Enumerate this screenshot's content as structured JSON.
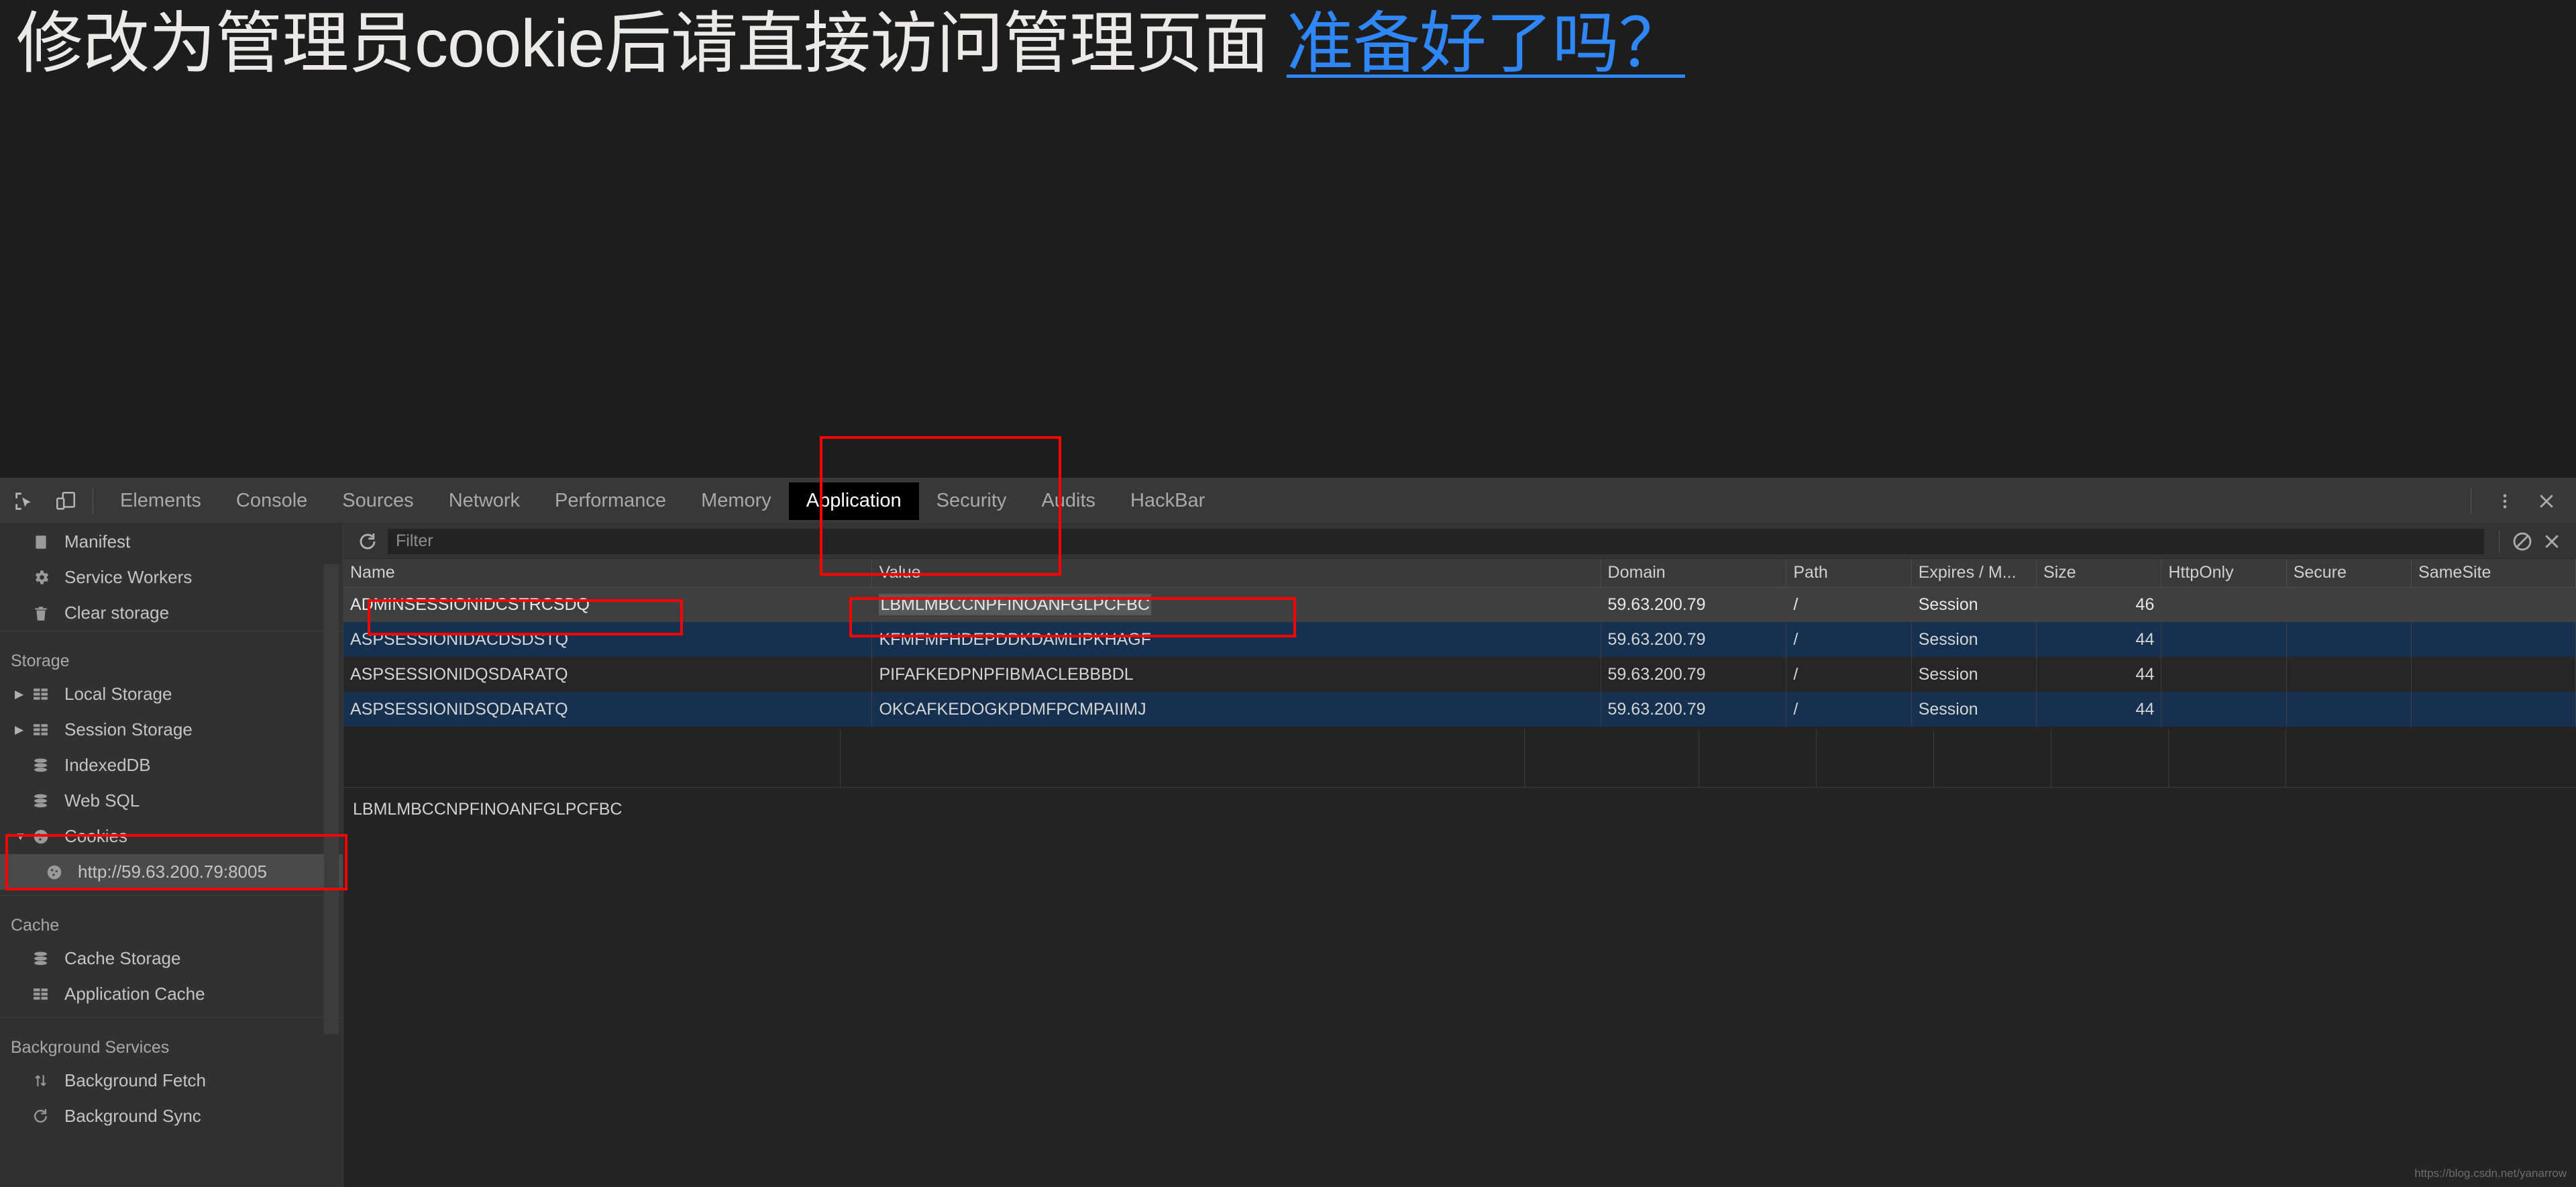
{
  "page": {
    "headline_text": "修改为管理员cookie后请直接访问管理页面 ",
    "headline_link": "准备好了吗？",
    "link_color": "#2f86f6"
  },
  "devtools": {
    "toolbar": {
      "inspect_icon": "inspect-element-icon",
      "device_icon": "device-toolbar-icon",
      "tabs": [
        {
          "label": "Elements",
          "active": false
        },
        {
          "label": "Console",
          "active": false
        },
        {
          "label": "Sources",
          "active": false
        },
        {
          "label": "Network",
          "active": false
        },
        {
          "label": "Performance",
          "active": false
        },
        {
          "label": "Memory",
          "active": false
        },
        {
          "label": "Application",
          "active": true
        },
        {
          "label": "Security",
          "active": false
        },
        {
          "label": "Audits",
          "active": false
        },
        {
          "label": "HackBar",
          "active": false
        }
      ],
      "more_icon": "kebab-menu-icon",
      "close_icon": "close-icon"
    },
    "sidebar": {
      "items_top": [
        {
          "label": "Manifest",
          "icon": "manifest-icon",
          "caret": "",
          "indent": false
        },
        {
          "label": "Service Workers",
          "icon": "gear-icon",
          "caret": "",
          "indent": false
        },
        {
          "label": "Clear storage",
          "icon": "trash-icon",
          "caret": "",
          "indent": false
        }
      ],
      "group_storage": "Storage",
      "items_storage": [
        {
          "label": "Local Storage",
          "icon": "table-icon",
          "caret": "▶",
          "indent": false,
          "selected": false
        },
        {
          "label": "Session Storage",
          "icon": "table-icon",
          "caret": "▶",
          "indent": false,
          "selected": false
        },
        {
          "label": "IndexedDB",
          "icon": "database-icon",
          "caret": "",
          "indent": false,
          "selected": false
        },
        {
          "label": "Web SQL",
          "icon": "database-icon",
          "caret": "",
          "indent": false,
          "selected": false
        },
        {
          "label": "Cookies",
          "icon": "cookie-icon",
          "caret": "▼",
          "indent": false,
          "selected": false
        },
        {
          "label": "http://59.63.200.79:8005",
          "icon": "cookie-icon",
          "caret": "",
          "indent": true,
          "selected": true
        }
      ],
      "group_cache": "Cache",
      "items_cache": [
        {
          "label": "Cache Storage",
          "icon": "database-icon",
          "caret": "",
          "indent": false
        },
        {
          "label": "Application Cache",
          "icon": "table-icon",
          "caret": "",
          "indent": false
        }
      ],
      "group_background": "Background Services",
      "items_background": [
        {
          "label": "Background Fetch",
          "icon": "updown-arrows-icon",
          "caret": "",
          "indent": false
        },
        {
          "label": "Background Sync",
          "icon": "sync-icon",
          "caret": "",
          "indent": false
        }
      ]
    },
    "cookie_toolbar": {
      "refresh_icon": "refresh-icon",
      "filter_placeholder": "Filter",
      "filter_value": "",
      "clear_all_icon": "clear-all-cookies-icon",
      "delete_icon": "delete-selected-cookie-icon"
    },
    "cookie_table": {
      "columns": [
        "Name",
        "Value",
        "Domain",
        "Path",
        "Expires / M...",
        "Size",
        "HttpOnly",
        "Secure",
        "SameSite"
      ],
      "rows": [
        {
          "name": "ADMINSESSIONIDCSTRCSDQ",
          "value": "LBMLMBCCNPFINOANFGLPCFBC",
          "domain": "59.63.200.79",
          "path": "/",
          "expires": "Session",
          "size": "46",
          "httponly": "",
          "secure": "",
          "samesite": "",
          "state": "selected"
        },
        {
          "name": "ASPSESSIONIDACDSDSTQ",
          "value": "KFMFMFHDEPDDKDAMLIPKHAGF",
          "domain": "59.63.200.79",
          "path": "/",
          "expires": "Session",
          "size": "44",
          "httponly": "",
          "secure": "",
          "samesite": "",
          "state": "odd"
        },
        {
          "name": "ASPSESSIONIDQSDARATQ",
          "value": "PIFAFKEDPNPFIBMACLEBBBDL",
          "domain": "59.63.200.79",
          "path": "/",
          "expires": "Session",
          "size": "44",
          "httponly": "",
          "secure": "",
          "samesite": "",
          "state": "even"
        },
        {
          "name": "ASPSESSIONIDSQDARATQ",
          "value": "OKCAFKEDOGKPDMFPCMPAIIMJ",
          "domain": "59.63.200.79",
          "path": "/",
          "expires": "Session",
          "size": "44",
          "httponly": "",
          "secure": "",
          "samesite": "",
          "state": "odd"
        }
      ]
    },
    "cookie_preview": {
      "value": "LBMLMBCCNPFINOANFGLPCFBC"
    },
    "annotations": {
      "highlight_color": "#ff0000",
      "boxes": [
        "application-tab-highlight",
        "cookie-name-cell-highlight",
        "cookie-value-cell-highlight",
        "cookies-tree-highlight"
      ]
    }
  },
  "watermark": {
    "text": "https://blog.csdn.net/yanarrow"
  }
}
